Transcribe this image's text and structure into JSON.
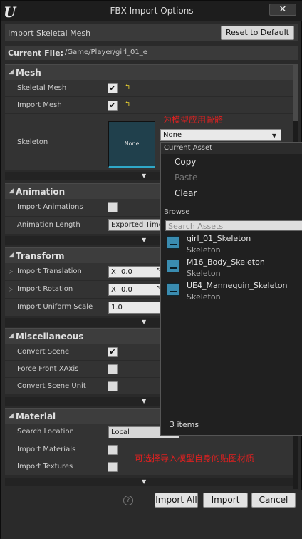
{
  "window": {
    "title": "FBX Import Options",
    "close": "✕"
  },
  "header": {
    "import_label": "Import Skeletal Mesh",
    "reset_button": "Reset to Default",
    "current_file_label": "Current File:",
    "current_file_value": "/Game/Player/girl_01_e"
  },
  "sections": {
    "mesh": {
      "title": "Mesh",
      "skeletal_mesh": "Skeletal Mesh",
      "import_mesh": "Import Mesh",
      "skeleton": "Skeleton",
      "skeleton_thumb": "None",
      "skeleton_value": "None",
      "annotation": "为模型应用骨骼"
    },
    "animation": {
      "title": "Animation",
      "import_animations": "Import Animations",
      "animation_length": "Animation Length",
      "animation_length_value": "Exported Time"
    },
    "transform": {
      "title": "Transform",
      "import_translation": "Import Translation",
      "import_rotation": "Import Rotation",
      "import_uniform_scale": "Import Uniform Scale",
      "axis_x": "X",
      "translation_x": "0.0",
      "rotation_x": "0.0",
      "scale_value": "1.0"
    },
    "misc": {
      "title": "Miscellaneous",
      "convert_scene": "Convert Scene",
      "force_front_xaxis": "Force Front XAxis",
      "convert_scene_unit": "Convert Scene Unit"
    },
    "material": {
      "title": "Material",
      "search_location": "Search Location",
      "search_location_value": "Local",
      "import_materials": "Import Materials",
      "import_textures": "Import Textures",
      "annotation": "可选择导入模型自身的贴图材质"
    }
  },
  "checkboxes": {
    "skeletal_mesh": true,
    "import_mesh": true,
    "import_animations": false,
    "convert_scene": true,
    "force_front_xaxis": false,
    "convert_scene_unit": false,
    "import_materials": false,
    "import_textures": false
  },
  "dropdown": {
    "current_asset_header": "Current Asset",
    "copy": "Copy",
    "paste": "Paste",
    "clear": "Clear",
    "browse_header": "Browse",
    "search_placeholder": "Search Assets",
    "assets": [
      {
        "name": "girl_01_Skeleton",
        "type": "Skeleton"
      },
      {
        "name": "M16_Body_Skeleton",
        "type": "Skeleton"
      },
      {
        "name": "UE4_Mannequin_Skeleton",
        "type": "Skeleton"
      }
    ],
    "count": "3 items"
  },
  "footer": {
    "help": "?",
    "import_all": "Import All",
    "import": "Import",
    "cancel": "Cancel"
  },
  "colors": {
    "annotation": "#e02020",
    "thumbnail_bg": "#20404c",
    "thumbnail_accent": "#2fa8c8",
    "asset_icon": "#3a8cb0"
  }
}
